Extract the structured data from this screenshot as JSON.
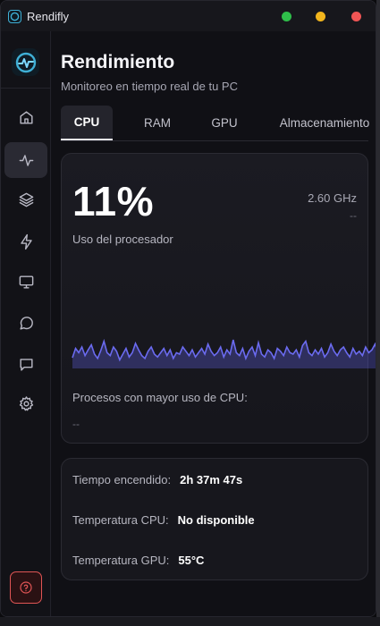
{
  "window": {
    "title": "Rendifly"
  },
  "colors": {
    "accent": "#5b5bd6",
    "graph_line": "#6b6bf0",
    "danger": "#e05555"
  },
  "sidebar": {
    "items": [
      {
        "icon": "home-icon",
        "active": false
      },
      {
        "icon": "activity-icon",
        "active": true
      },
      {
        "icon": "layers-icon",
        "active": false
      },
      {
        "icon": "lightning-icon",
        "active": false
      },
      {
        "icon": "monitor-icon",
        "active": false
      },
      {
        "icon": "chat-icon",
        "active": false
      },
      {
        "icon": "message-icon",
        "active": false
      },
      {
        "icon": "gear-icon",
        "active": false
      }
    ],
    "help_icon": "help-icon"
  },
  "header": {
    "title": "Rendimiento",
    "subtitle": "Monitoreo en tiempo real de tu PC"
  },
  "tabs": [
    {
      "label": "CPU",
      "active": true
    },
    {
      "label": "RAM",
      "active": false
    },
    {
      "label": "GPU",
      "active": false
    },
    {
      "label": "Almacenamiento",
      "active": false
    }
  ],
  "cpu": {
    "usage": "11%",
    "usage_label": "Uso del procesador",
    "frequency": "2.60 GHz",
    "frequency_sub": "--",
    "history": [
      15,
      28,
      22,
      30,
      18,
      26,
      33,
      20,
      14,
      25,
      38,
      22,
      18,
      30,
      24,
      12,
      20,
      28,
      16,
      22,
      35,
      26,
      18,
      14,
      24,
      30,
      20,
      16,
      22,
      28,
      18,
      26,
      14,
      22,
      20,
      30,
      24,
      18,
      26,
      16,
      22,
      28,
      20,
      34,
      24,
      18,
      22,
      30,
      16,
      26,
      20,
      40,
      22,
      18,
      28,
      14,
      24,
      30,
      18,
      36,
      20,
      16,
      26,
      22,
      14,
      28,
      24,
      18,
      30,
      22,
      20,
      26,
      16,
      32,
      38,
      22,
      18,
      26,
      20,
      28,
      16,
      22,
      34,
      24,
      18,
      26,
      30,
      22,
      16,
      28,
      20,
      24,
      18,
      30,
      22,
      26,
      34,
      20
    ],
    "processes_label": "Procesos con mayor uso de CPU:",
    "processes_value": "--"
  },
  "info": {
    "uptime_label": "Tiempo encendido:",
    "uptime_value": "2h 37m 47s",
    "cpu_temp_label": "Temperatura CPU:",
    "cpu_temp_value": "No disponible",
    "gpu_temp_label": "Temperatura GPU:",
    "gpu_temp_value": "55°C"
  }
}
